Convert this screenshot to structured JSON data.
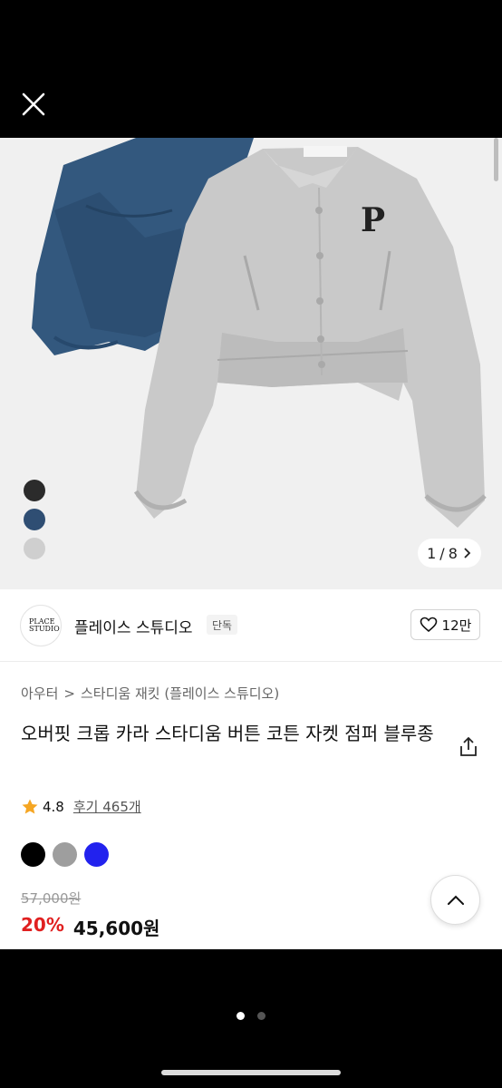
{
  "hero": {
    "swatches": [
      "#2b2b2b",
      "#2f4e73",
      "#cfcfcf"
    ],
    "counter": {
      "current": "1",
      "separator": "/",
      "total": "8"
    },
    "patch_letter": "P"
  },
  "brand": {
    "logo_text": "PLACE STUDIO",
    "name": "플레이스 스튜디오",
    "badge": "단독",
    "likes": "12만"
  },
  "breadcrumb": [
    "아우터",
    ">",
    "스타디움 재킷 (플레이스 스튜디오)"
  ],
  "product": {
    "title": "오버핏 크롭 카라 스타디움 버튼 코튼 자켓 점퍼 블루종",
    "rating": "4.8",
    "reviews": "후기 465개",
    "colors": [
      "#000000",
      "#9e9e9e",
      "#2222ee"
    ],
    "original_price": "57,000원",
    "discount": "20%",
    "price": "45,600원"
  },
  "pager": {
    "total": 2,
    "active": 0
  },
  "colors": {
    "accent_red": "#e02020",
    "star": "#f5a623"
  }
}
